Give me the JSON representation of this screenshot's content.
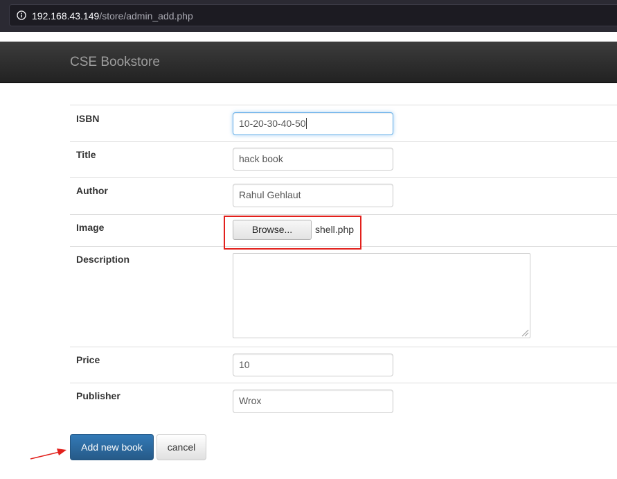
{
  "browser": {
    "url_host": "192.168.43.149",
    "url_path": "/store/admin_add.php"
  },
  "navbar": {
    "brand": "CSE Bookstore"
  },
  "form": {
    "isbn": {
      "label": "ISBN",
      "value": "10-20-30-40-50"
    },
    "title": {
      "label": "Title",
      "value": "hack book"
    },
    "author": {
      "label": "Author",
      "value": "Rahul Gehlaut"
    },
    "image": {
      "label": "Image",
      "browse_label": "Browse...",
      "file_name": "shell.php"
    },
    "description": {
      "label": "Description",
      "value": ""
    },
    "price": {
      "label": "Price",
      "value": "10"
    },
    "publisher": {
      "label": "Publisher",
      "value": "Wrox"
    }
  },
  "actions": {
    "submit_label": "Add new book",
    "cancel_label": "cancel"
  },
  "colors": {
    "primary": "#337ab7",
    "highlight_box": "#e2201c",
    "annotation_arrow": "#e2201c"
  },
  "icons": {
    "url_info": "info-icon",
    "annotation": "arrow-icon"
  }
}
